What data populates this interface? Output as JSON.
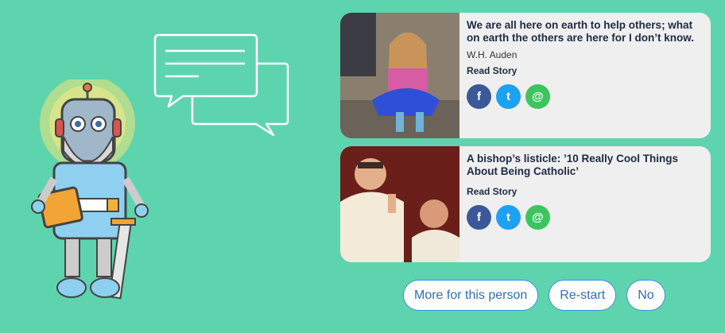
{
  "stories": [
    {
      "quote": "We are all here on earth to help others; what on earth the others are here for I don’t know.",
      "author": "W.H. Auden",
      "read_label": "Read Story",
      "share": {
        "facebook": "f",
        "twitter": "t",
        "email": "@"
      }
    },
    {
      "quote": "A bishop’s listicle: ’10 Really Cool Things About Being Catholic’",
      "read_label": "Read Story",
      "share": {
        "facebook": "f",
        "twitter": "t",
        "email": "@"
      }
    }
  ],
  "actions": {
    "more": "More for this person",
    "restart": "Re-start",
    "no": "No"
  },
  "colors": {
    "background": "#5ed4ae",
    "card": "#efefef",
    "facebook": "#3b5998",
    "twitter": "#1da1f2",
    "email": "#3ec45e",
    "accent": "#3c8fd8"
  },
  "icons": [
    "robot-illustration",
    "chat-bubbles-icon",
    "facebook-icon",
    "twitter-icon",
    "email-icon"
  ]
}
